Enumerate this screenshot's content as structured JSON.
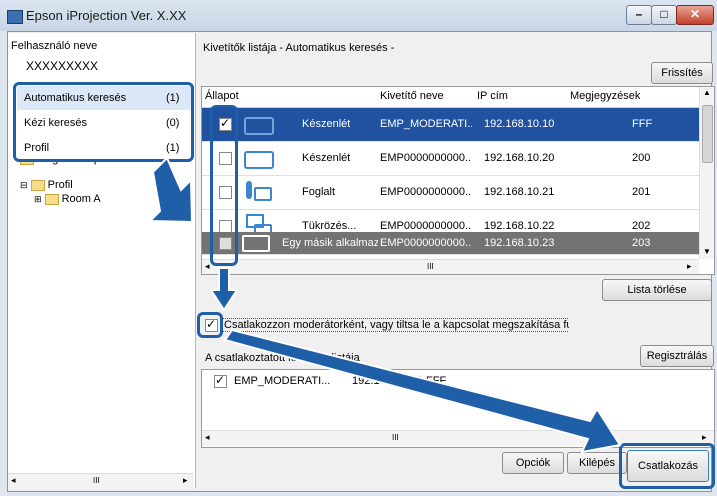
{
  "window": {
    "title": "Epson iProjection Ver. X.XX"
  },
  "left": {
    "user_label": "Felhasználó neve",
    "user_value": "XXXXXXXXX",
    "items": [
      {
        "label": "Automatikus keresés",
        "count": "(1)"
      },
      {
        "label": "Kézi keresés",
        "count": "(0)"
      },
      {
        "label": "Profil",
        "count": "(1)"
      }
    ],
    "tree": {
      "shared": "Megosztott profil",
      "profil": "Profil",
      "room": "Room A"
    },
    "hscroll_mid": "III"
  },
  "main": {
    "list_title": "Kivetítők listája - Automatikus keresés -",
    "refresh_button": "Frissítés",
    "columns": [
      "Állapot",
      "Kivetítő neve",
      "IP cím",
      "Megjegyzések"
    ],
    "rows": [
      {
        "checked": true,
        "status": "Készenlét",
        "name": "EMP_MODERATI...",
        "ip": "192.168.10.10",
        "note": "FFF"
      },
      {
        "checked": false,
        "status": "Készenlét",
        "name": "EMP0000000000...",
        "ip": "192.168.10.20",
        "note": "200"
      },
      {
        "checked": false,
        "status": "Foglalt",
        "name": "EMP0000000000...",
        "ip": "192.168.10.21",
        "note": "201"
      },
      {
        "checked": false,
        "status": "Tükrözés...",
        "name": "EMP0000000000...",
        "ip": "192.168.10.22",
        "note": "202"
      },
      {
        "checked": false,
        "status": "Egy másik alkalmaz...",
        "name": "EMP0000000000...",
        "ip": "192.168.10.23",
        "note": "203"
      }
    ],
    "grid_hscroll_mid": "III",
    "clear_list_button": "Lista törlése",
    "moderator_checkbox_label": "Csatlakozzon moderátorként, vagy tiltsa le a kapcsolat megszakítása funkciót",
    "connected_list_label": "A csatlakoztatott kivetítők listája",
    "register_button": "Regisztrálás",
    "connected_rows": [
      {
        "name": "EMP_MODERATI...",
        "ip": "192.168.10.10",
        "note": "FFF"
      }
    ],
    "connected_hscroll_mid": "III",
    "options_button": "Opciók",
    "cancel_button": "Kilépés",
    "connect_button": "Csatlakozás"
  },
  "colors": {
    "accent": "#1e5fa8",
    "selected_row": "#2052a0"
  }
}
